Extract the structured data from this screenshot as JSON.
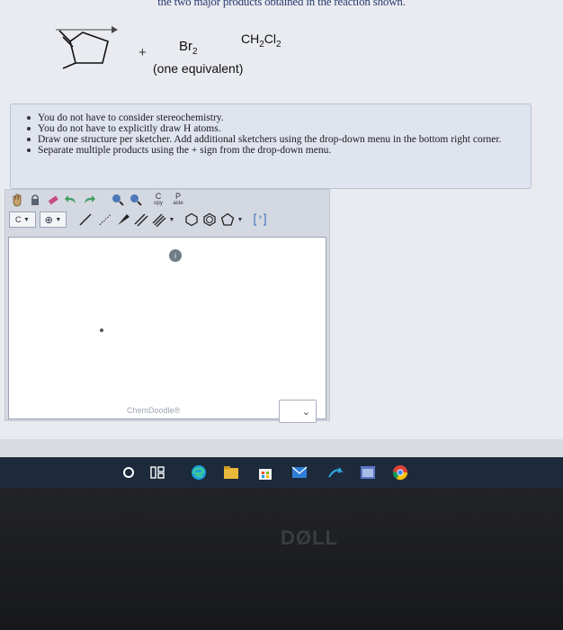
{
  "question": {
    "header_text": "the two major products obtained in the reaction shown.",
    "reagent": "Br",
    "reagent_sub": "2",
    "reagent_note": "(one equivalent)",
    "plus": "+",
    "solvent_prefix": "CH",
    "solvent_sub1": "2",
    "solvent_mid": "Cl",
    "solvent_sub2": "2"
  },
  "instructions": [
    "You do not have to consider stereochemistry.",
    "You do not have to explicitly draw H atoms.",
    "Draw one structure per sketcher. Add additional sketchers using the drop-down menu in the bottom right corner.",
    "Separate multiple products using the + sign from the drop-down menu."
  ],
  "sketcher": {
    "copy_label_top": "C",
    "copy_label_bottom": "opy",
    "paste_label_top": "P",
    "paste_label_bottom": "aste",
    "carbon_label": "C",
    "watermark": "ChemDoodle®",
    "badge": "i"
  },
  "dropdown": {
    "chevron": "⌄"
  },
  "brand": "DØLL",
  "colors": {
    "accent": "#2a3a70",
    "taskbar": "#1c2a3c"
  }
}
